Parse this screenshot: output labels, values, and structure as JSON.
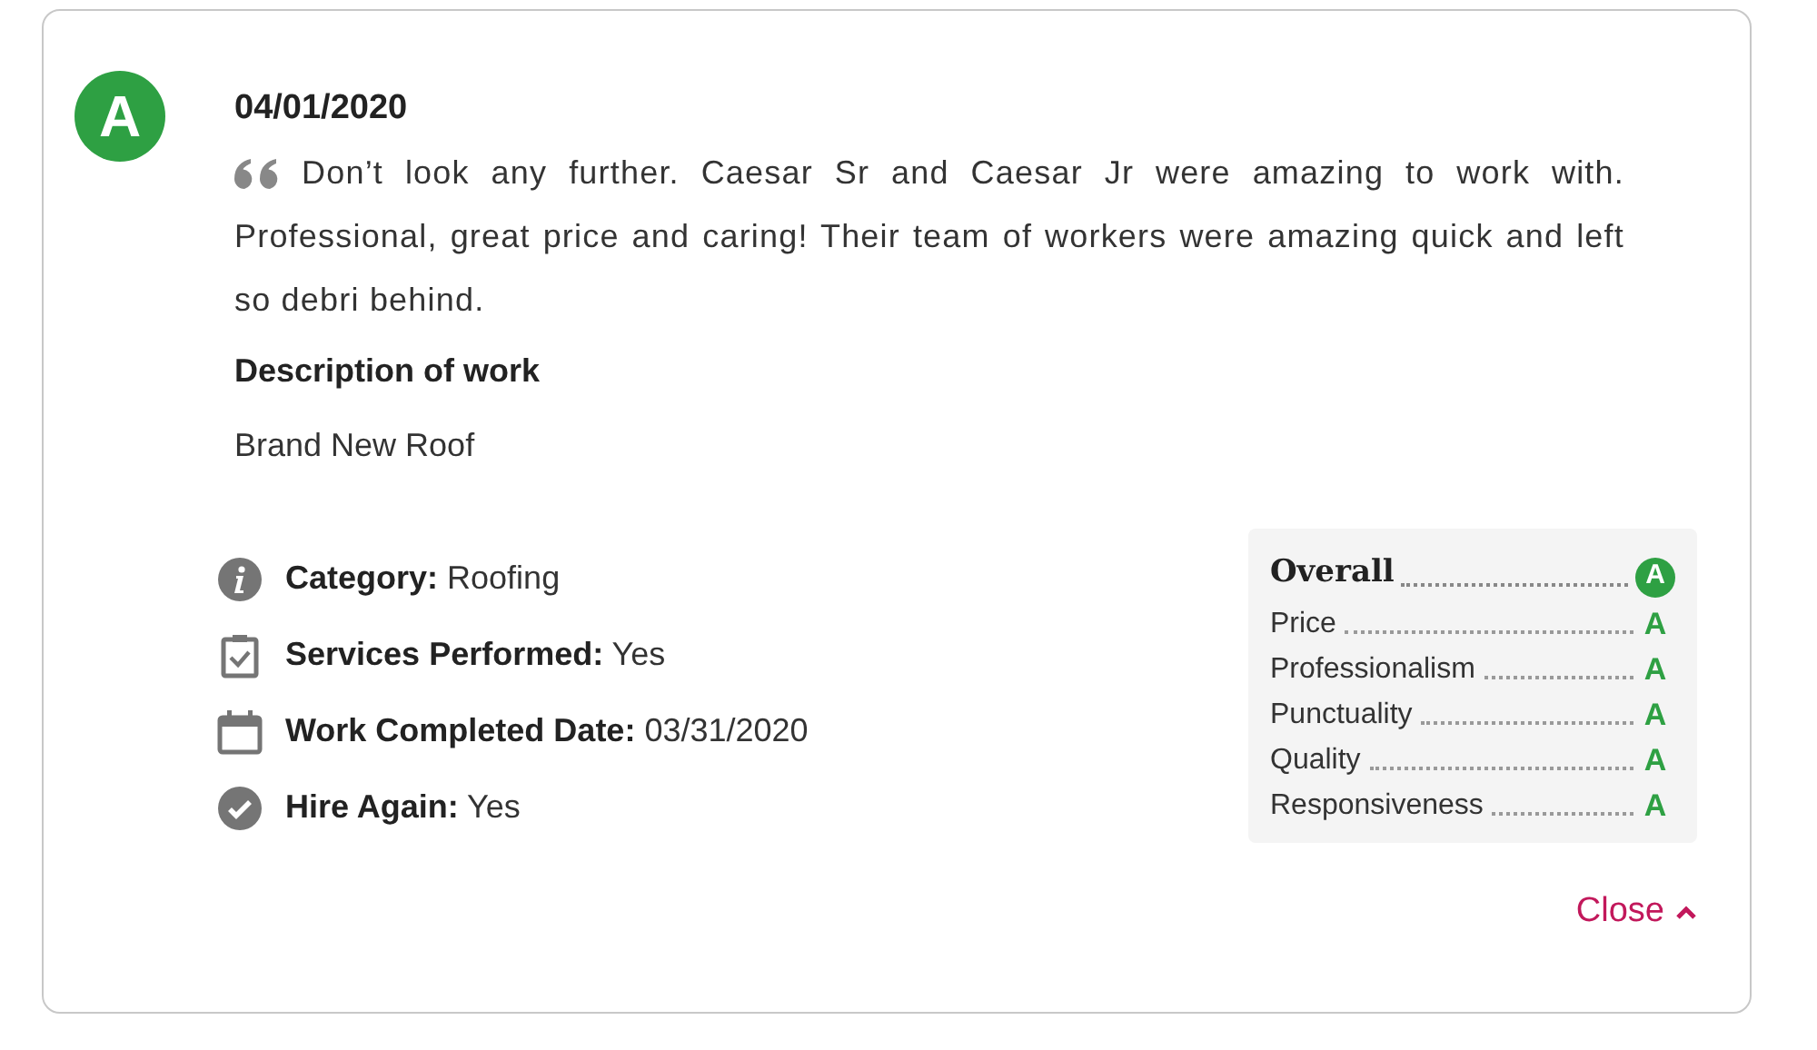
{
  "review": {
    "grade": "A",
    "date": "04/01/2020",
    "text_lines": [
      "Don’t look any further. Caesar Sr and Caesar Jr were amazing to work with.",
      "Professional, great price and caring! Their team of workers were amazing quick and left so debri behind."
    ],
    "description_label": "Description of work",
    "description": "Brand New Roof"
  },
  "details": [
    {
      "kind": "info",
      "label": "Category:",
      "value": "Roofing"
    },
    {
      "kind": "clipboard",
      "label": "Services Performed:",
      "value": "Yes"
    },
    {
      "kind": "calendar",
      "label": "Work Completed Date:",
      "value": "03/31/2020"
    },
    {
      "kind": "check",
      "label": "Hire Again:",
      "value": "Yes"
    }
  ],
  "ratings": {
    "overall": {
      "label": "Overall",
      "grade": "A"
    },
    "items": [
      {
        "label": "Price",
        "grade": "A"
      },
      {
        "label": "Professionalism",
        "grade": "A"
      },
      {
        "label": "Punctuality",
        "grade": "A"
      },
      {
        "label": "Quality",
        "grade": "A"
      },
      {
        "label": "Responsiveness",
        "grade": "A"
      }
    ]
  },
  "close_link": "Close"
}
